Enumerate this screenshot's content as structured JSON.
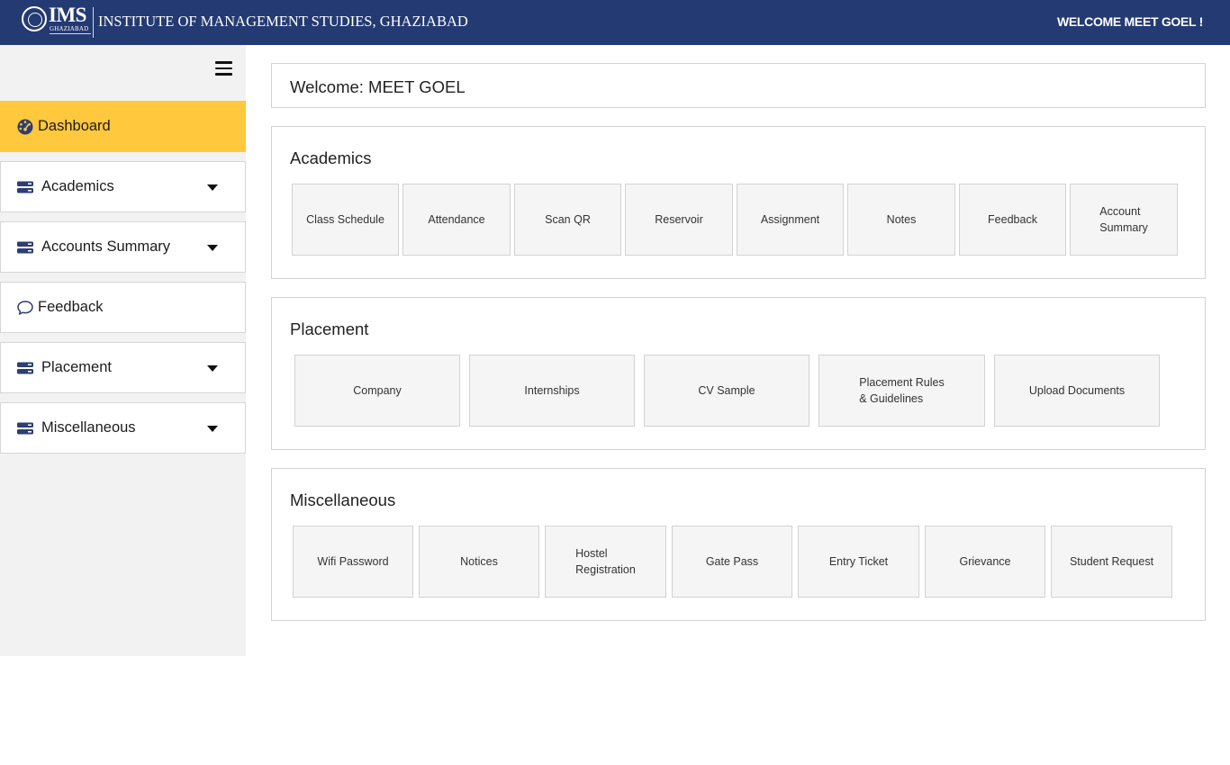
{
  "header": {
    "logo_text": "IMS",
    "logo_subtext": "GHAZIABAD",
    "institute_name": "INSTITUTE OF MANAGEMENT STUDIES, GHAZIABAD",
    "welcome_user": "WELCOME MEET GOEL !"
  },
  "sidebar": {
    "menu_icon": "hamburger-icon",
    "items": [
      {
        "label": "Dashboard",
        "icon": "dashboard-gauge-icon",
        "active": true,
        "expandable": false
      },
      {
        "label": "Academics",
        "icon": "server-stack-icon",
        "active": false,
        "expandable": true
      },
      {
        "label": "Accounts Summary",
        "icon": "server-stack-icon",
        "active": false,
        "expandable": true
      },
      {
        "label": "Feedback",
        "icon": "chat-bubble-icon",
        "active": false,
        "expandable": false
      },
      {
        "label": "Placement",
        "icon": "server-stack-icon",
        "active": false,
        "expandable": true
      },
      {
        "label": "Miscellaneous",
        "icon": "server-stack-icon",
        "active": false,
        "expandable": true
      }
    ]
  },
  "main": {
    "welcome": "Welcome: MEET GOEL",
    "sections": [
      {
        "title": "Academics",
        "tiles": [
          "Class Schedule",
          "Attendance",
          "Scan QR",
          "Reservoir",
          "Assignment",
          "Notes",
          "Feedback",
          "Account\nSummary"
        ]
      },
      {
        "title": "Placement",
        "tiles": [
          "Company",
          "Internships",
          "CV Sample",
          "Placement Rules\n& Guidelines",
          "Upload Documents"
        ]
      },
      {
        "title": "Miscellaneous",
        "tiles": [
          "Wifi Password",
          "Notices",
          "Hostel\nRegistration",
          "Gate Pass",
          "Entry Ticket",
          "Grievance",
          "Student Request"
        ]
      }
    ]
  },
  "colors": {
    "header_bg": "#243a73",
    "active_nav": "#ffc83d",
    "sidebar_bg": "#f2f2f2",
    "tile_bg": "#f5f5f5",
    "icon_color": "#2c3e74"
  }
}
